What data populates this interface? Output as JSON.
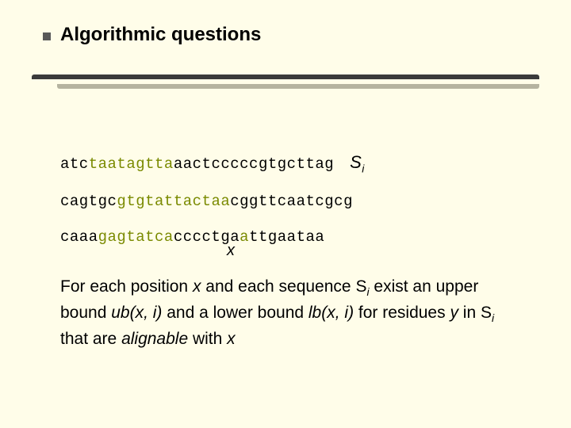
{
  "title": "Algorithmic questions",
  "seq1": {
    "p1": "atc",
    "p2": "taatagtta",
    "p3": "aactcccccgtgcttag",
    "label": "S",
    "labelSub": "i"
  },
  "seq2": {
    "p1": "cagtgc",
    "p2": "gtgtattactaa",
    "p3": "cggttcaatcgcg"
  },
  "seq3": {
    "p1": "caaa",
    "p2": "gagtatca",
    "p3": "cccctga",
    "p4": "a",
    "p5": "ttgaataa",
    "xLabel": "x"
  },
  "para": {
    "t1": "For each position ",
    "x": "x",
    "t2": " and each sequence ",
    "S": "S",
    "Si": "i",
    "t3": " exist an upper bound ",
    "ub": "ub(x, i)",
    "t4": " and a lower bound ",
    "lb": "lb(x, i)",
    "t5": " for residues ",
    "y": "y",
    "t6": " in ",
    "t7": " that are ",
    "align": "alignable",
    "t8": " with "
  }
}
